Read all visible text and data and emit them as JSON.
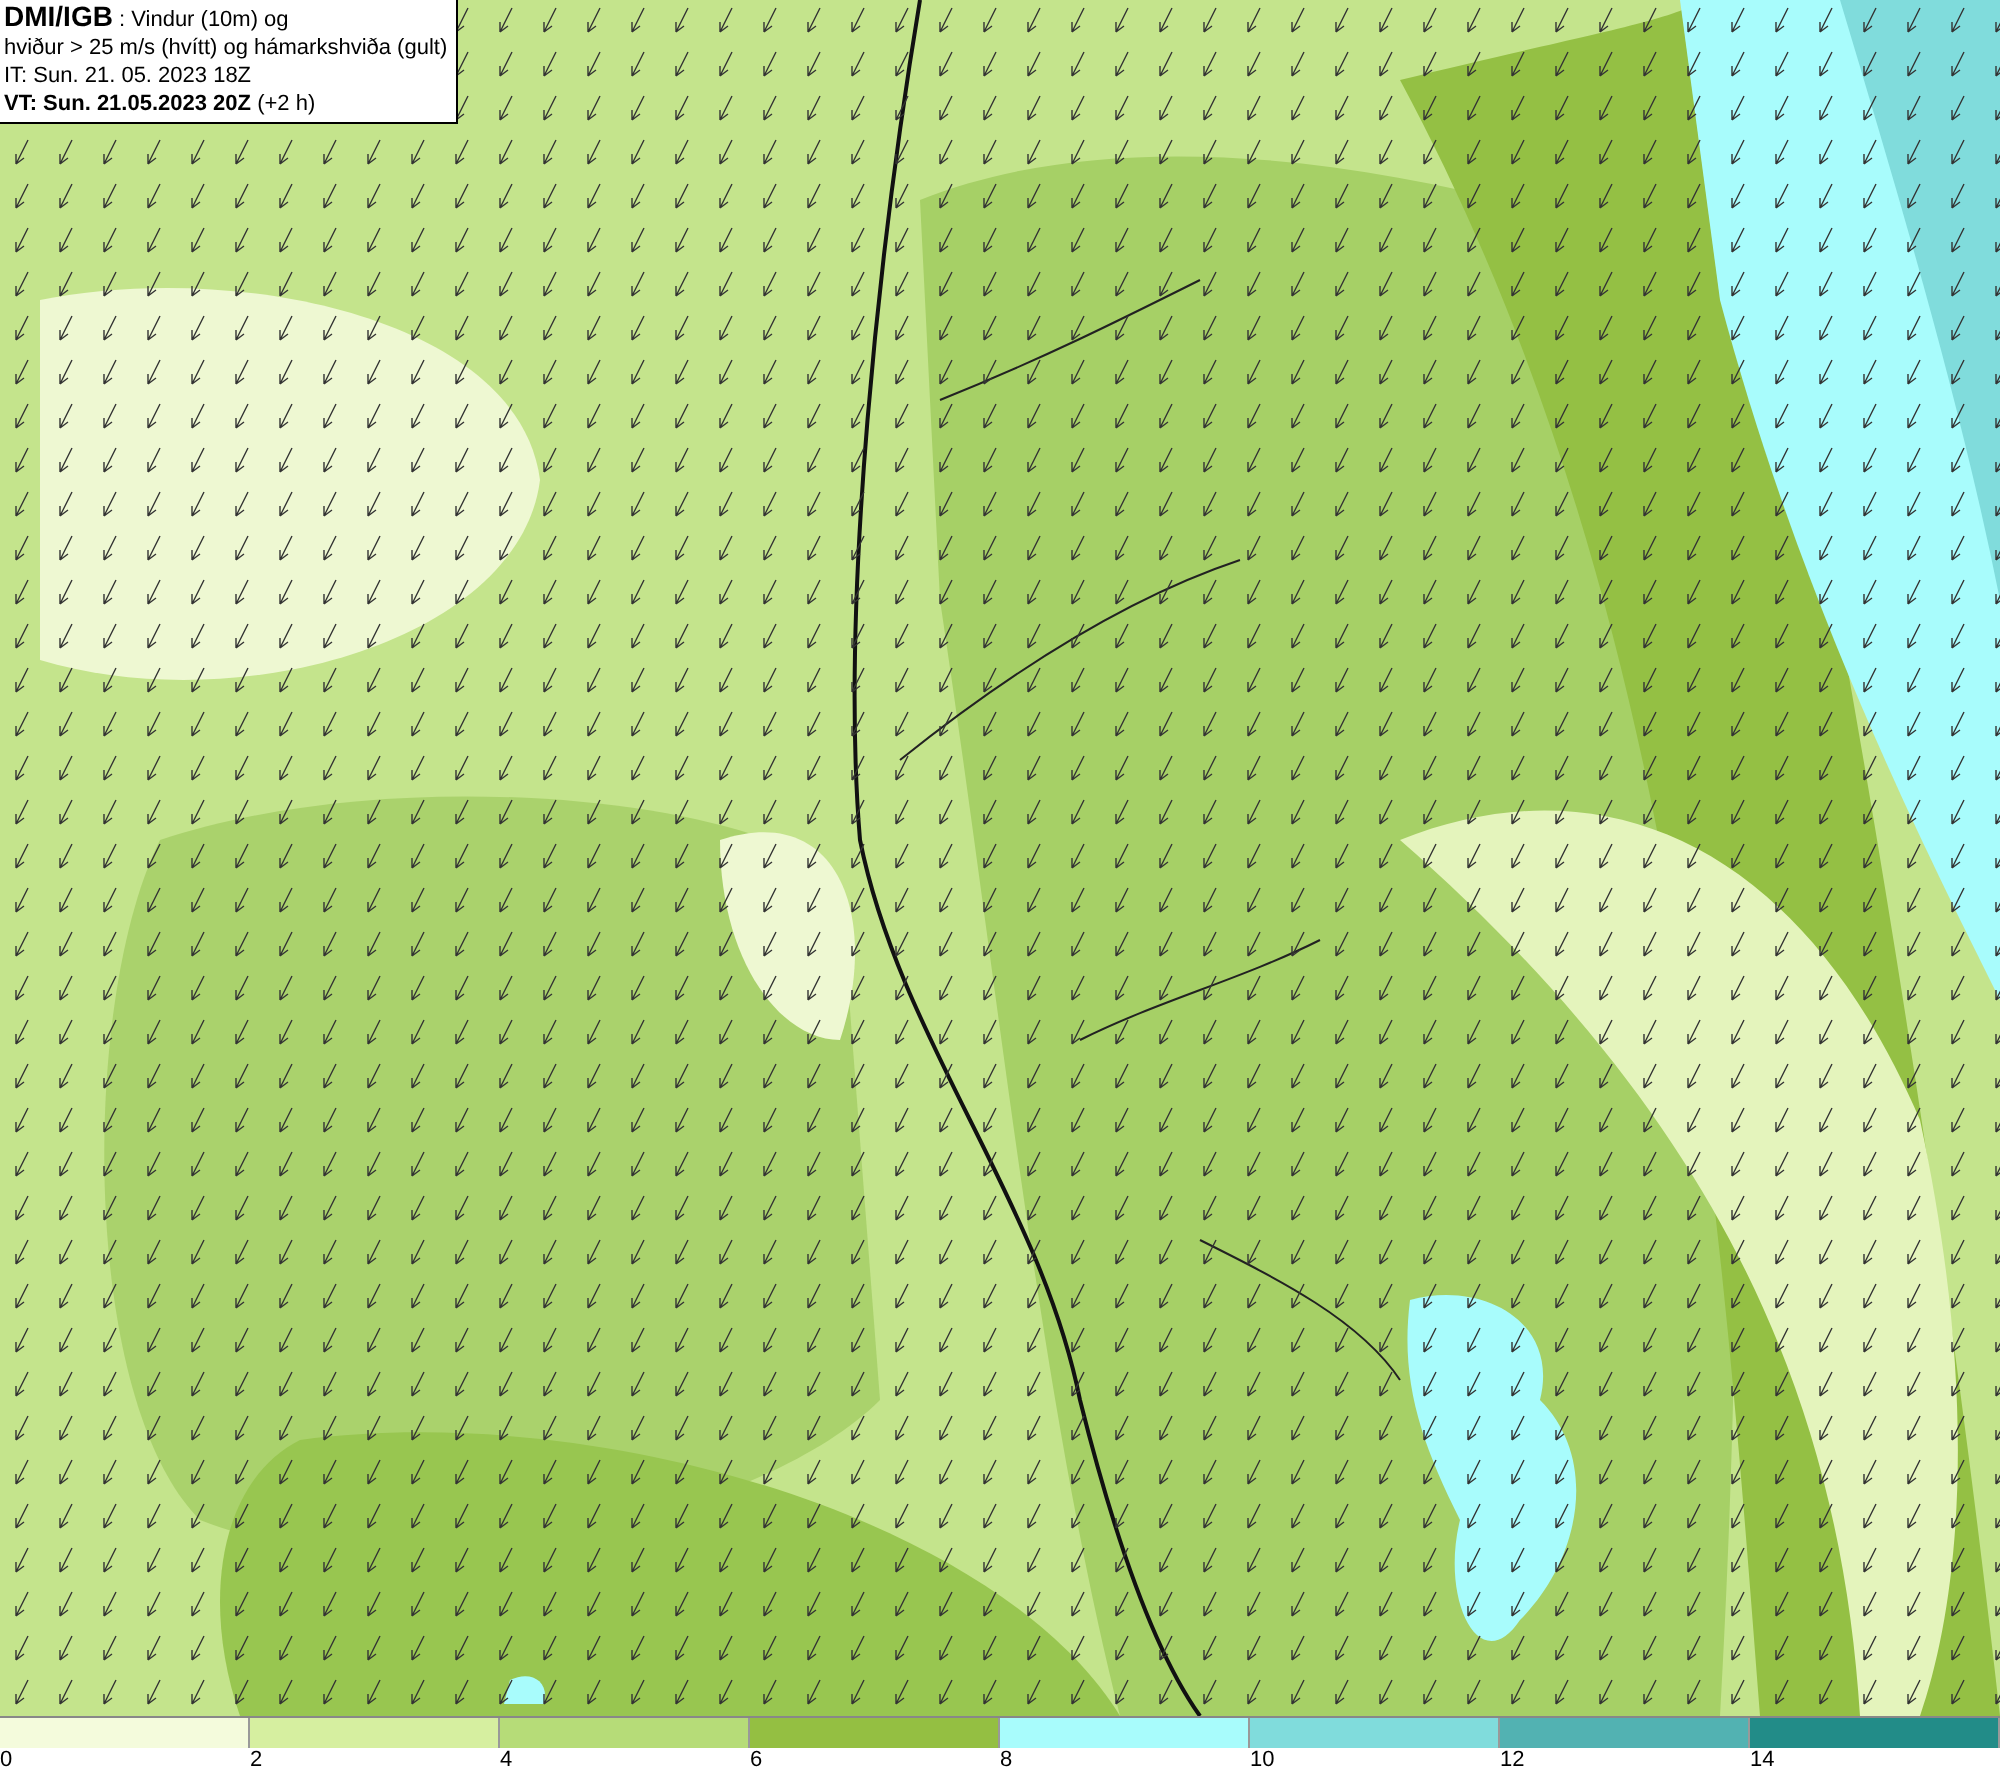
{
  "header": {
    "lines": [
      "**DMI/IGB** : Vindur (10m) og",
      "hviður > 25 m/s (hvítt) og hámarkshviða (gult)",
      "IT: Sun. 21. 05. 2023 18Z",
      "**VT: Sun. 21.05.2023 20Z** (+2 h)"
    ]
  },
  "legend": {
    "bins": [
      {
        "color": "#f4fbdc"
      },
      {
        "color": "#d6efa0"
      },
      {
        "color": "#b6dc78"
      },
      {
        "color": "#94bf42"
      },
      {
        "color": "#a8fcfc"
      },
      {
        "color": "#80dcdc"
      },
      {
        "color": "#52b2b2"
      },
      {
        "color": "#228c88"
      }
    ],
    "ticks": [
      "0",
      "2",
      "4",
      "6",
      "8",
      "10",
      "12",
      "14"
    ]
  }
}
